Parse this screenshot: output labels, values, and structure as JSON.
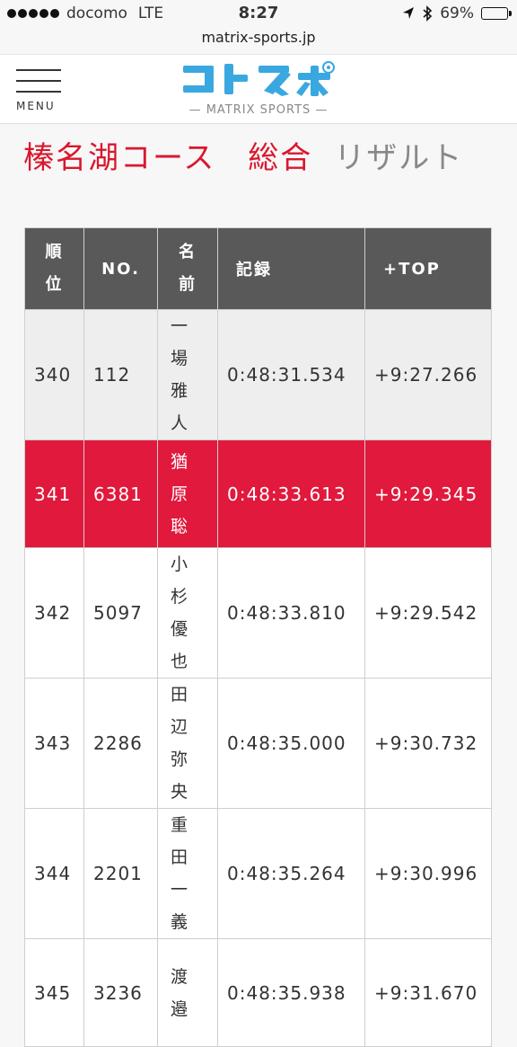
{
  "status": {
    "carrier": "docomo",
    "network": "LTE",
    "time": "8:27",
    "battery": "69%",
    "battery_level": 0.69
  },
  "browser": {
    "url": "matrix-sports.jp"
  },
  "header": {
    "menu_label": "MENU",
    "logo_sub": "— MATRIX SPORTS —",
    "logo_color": "#3aa8e0"
  },
  "title": {
    "main": "榛名湖コース　総合",
    "sub": "リザルト"
  },
  "table": {
    "headers": {
      "rank": "順位",
      "no": "NO.",
      "name": "名前",
      "record": "記録",
      "top": "+TOP"
    },
    "rows": [
      {
        "rank": "340",
        "no": "112",
        "name": "一場雅人",
        "record": "0:48:31.534",
        "top": "+9:27.266"
      },
      {
        "rank": "341",
        "no": "6381",
        "name": "猶原聡",
        "record": "0:48:33.613",
        "top": "+9:29.345"
      },
      {
        "rank": "342",
        "no": "5097",
        "name": "小杉優也",
        "record": "0:48:33.810",
        "top": "+9:29.542"
      },
      {
        "rank": "343",
        "no": "2286",
        "name": "田辺弥央",
        "record": "0:48:35.000",
        "top": "+9:30.732"
      },
      {
        "rank": "344",
        "no": "2201",
        "name": "重田一義",
        "record": "0:48:35.264",
        "top": "+9:30.996"
      },
      {
        "rank": "345",
        "no": "3236",
        "name": "渡邉",
        "record": "0:48:35.938",
        "top": "+9:31.670"
      }
    ],
    "highlight_color": "#e1193c",
    "header_color": "#595959"
  }
}
